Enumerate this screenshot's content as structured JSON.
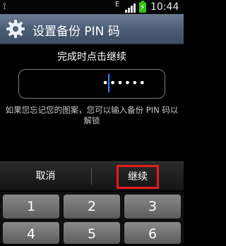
{
  "status_bar": {
    "usb_icon": "usb-icon",
    "network_type": "E",
    "time": "10:44",
    "battery_color": "#2cc40a"
  },
  "title_bar": {
    "icon": "gear-icon",
    "title": "设置备份 PIN 码"
  },
  "instruction": "完成时点击继续",
  "pin_field": {
    "value": "••••••"
  },
  "hint": "如果您忘记您的图案，您可以输入备份 PIN 码以解锁",
  "actions": {
    "cancel_label": "取消",
    "continue_label": "继续",
    "highlight_color": "#e61b1b"
  },
  "keypad": {
    "keys": [
      "1",
      "2",
      "3",
      "4",
      "5",
      "6"
    ]
  }
}
